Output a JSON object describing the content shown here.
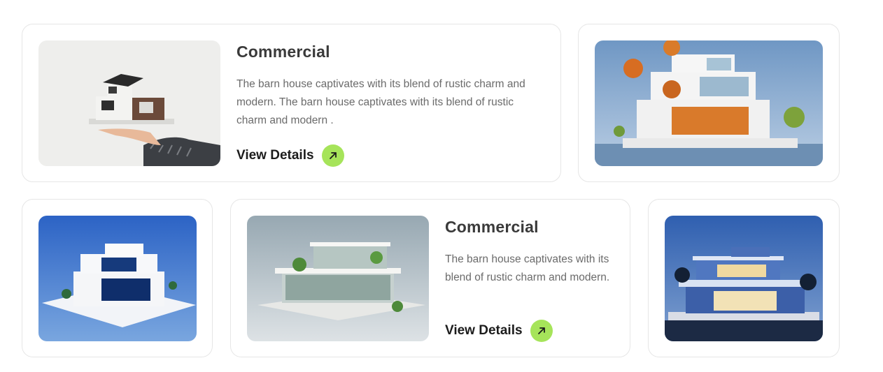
{
  "colors": {
    "accent": "#a6e45a",
    "title": "#3a3a3a",
    "text": "#6b6b6b",
    "border": "#e6e6e6"
  },
  "cards": [
    {
      "title": "Commercial",
      "description": "The barn house captivates with its blend of rustic charm and modern. The barn house captivates with its blend of rustic charm and modern .",
      "cta_label": "View Details",
      "cta_icon": "arrow-up-right-icon",
      "image": "house-model-in-hand-image"
    },
    {
      "image": "modern-house-with-autumn-trees-image"
    },
    {
      "image": "white-modern-house-blue-background-image"
    },
    {
      "title": "Commercial",
      "description": "The barn house captivates with its blend of rustic charm and modern.",
      "cta_label": "View Details",
      "cta_icon": "arrow-up-right-icon",
      "image": "glass-house-with-plants-image"
    },
    {
      "image": "modern-house-at-night-image"
    }
  ]
}
